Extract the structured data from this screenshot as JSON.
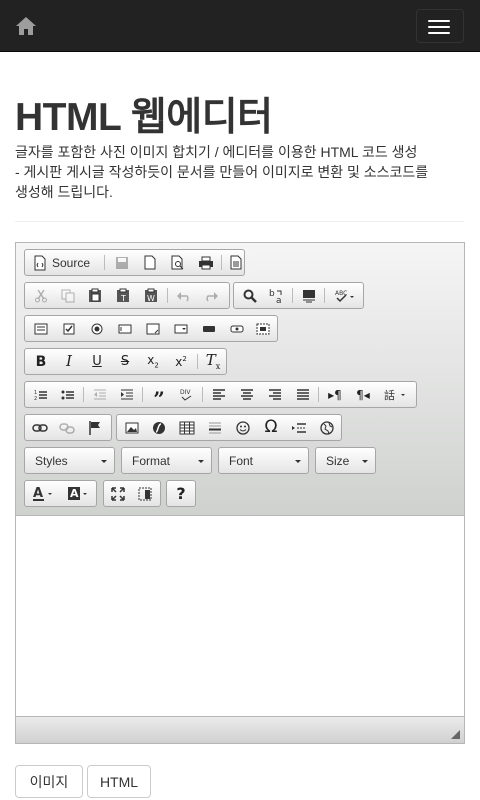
{
  "page": {
    "title": "HTML 웹에디터",
    "description_lines": [
      "글자를 포함한 사진 이미지 합치기 / 에디터를 이용한 HTML 코드 생성",
      "- 게시판 게시글 작성하듯이 문서를 만들어 이미지로 변환 및 소스코드를",
      "생성해 드립니다."
    ]
  },
  "navbar": {
    "home_icon": "home-icon",
    "menu_icon": "hamburger-menu-icon"
  },
  "toolbar": {
    "source_label": "Source",
    "combos": {
      "styles": "Styles",
      "format": "Format",
      "font": "Font",
      "size": "Size"
    }
  },
  "buttons": {
    "image": "이미지",
    "html": "HTML"
  },
  "colors": {
    "navbar_bg": "#222222",
    "title": "#333333"
  }
}
